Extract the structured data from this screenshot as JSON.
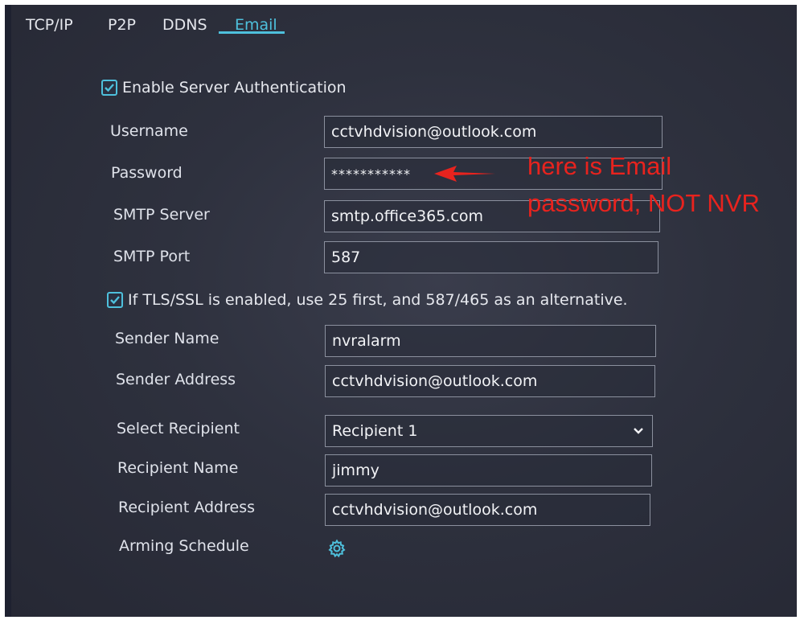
{
  "tabs": [
    {
      "label": "TCP/IP",
      "active": false
    },
    {
      "label": "P2P",
      "active": false
    },
    {
      "label": "DDNS",
      "active": false
    },
    {
      "label": "Email",
      "active": true
    }
  ],
  "enable_auth": {
    "label": "Enable Server Authentication",
    "checked": true
  },
  "fields": {
    "username": {
      "label": "Username",
      "value": "cctvhdvision@outlook.com"
    },
    "password": {
      "label": "Password",
      "value": "***********"
    },
    "smtp_server": {
      "label": "SMTP Server",
      "value": "smtp.office365.com"
    },
    "smtp_port": {
      "label": "SMTP Port",
      "value": "587"
    }
  },
  "tls": {
    "label": "If TLS/SSL is enabled, use 25 first, and 587/465 as an alternative.",
    "checked": true
  },
  "sender": {
    "name": {
      "label": "Sender Name",
      "value": "nvralarm"
    },
    "address": {
      "label": "Sender Address",
      "value": "cctvhdvision@outlook.com"
    }
  },
  "recipient": {
    "select": {
      "label": "Select Recipient",
      "value": "Recipient 1"
    },
    "name": {
      "label": "Recipient Name",
      "value": "jimmy"
    },
    "address": {
      "label": "Recipient Address",
      "value": "cctvhdvision@outlook.com"
    }
  },
  "arming_schedule": {
    "label": "Arming Schedule",
    "icon": "gear-icon"
  },
  "annotation": {
    "line1": "here is Email",
    "line2": "password, NOT NVR",
    "color": "#e8231e"
  },
  "colors": {
    "accent": "#4ec0dc",
    "background": "#2e313e"
  }
}
